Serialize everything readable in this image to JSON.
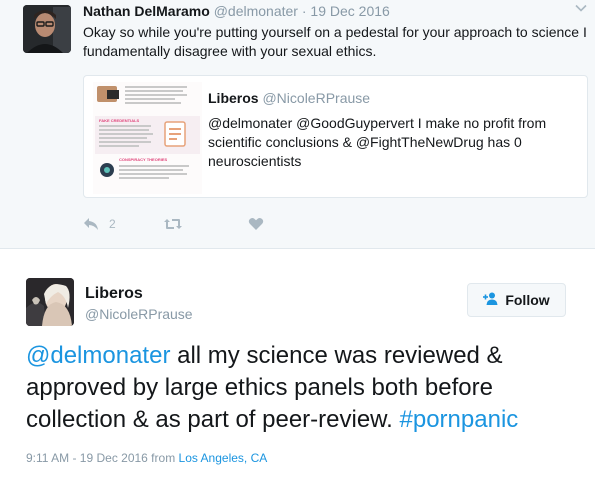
{
  "reply_tweet": {
    "author_name": "Nathan DelMaramo",
    "author_handle": "@delmonater",
    "separator": "·",
    "date": "19 Dec 2016",
    "text": "Okay so while you're putting yourself on a pedestal for your approach to science I fundamentally disagree with your sexual ethics.",
    "quoted": {
      "author_name": "Liberos",
      "author_handle": "@NicoleRPrause",
      "text": "@delmonater @GoodGuypervert I make no profit from scientific conclusions & @FightTheNewDrug has 0 neuroscientists",
      "thumbnail": {
        "heading_1": "FAKE CREDENTIALS",
        "heading_2": "CONSPIRACY THEORIES"
      }
    },
    "actions": {
      "reply_count": "2",
      "reply_icon": "reply-icon",
      "retweet_icon": "retweet-icon",
      "like_icon": "heart-icon"
    }
  },
  "main_tweet": {
    "author_name": "Liberos",
    "author_handle": "@NicoleRPrause",
    "follow_label": "Follow",
    "follow_icon": "follow-user-icon",
    "mention": "@delmonater",
    "text_body": " all my science was reviewed & approved by large ethics panels both before collection & as part of peer-review. ",
    "hashtag": "#pornpanic",
    "timestamp": "9:11 AM - 19 Dec 2016 from ",
    "location": "Los Angeles, CA"
  },
  "colors": {
    "link": "#1b95e0",
    "muted": "#8899a6",
    "icon": "#aab8c2",
    "accent_pink": "#e0457b"
  }
}
